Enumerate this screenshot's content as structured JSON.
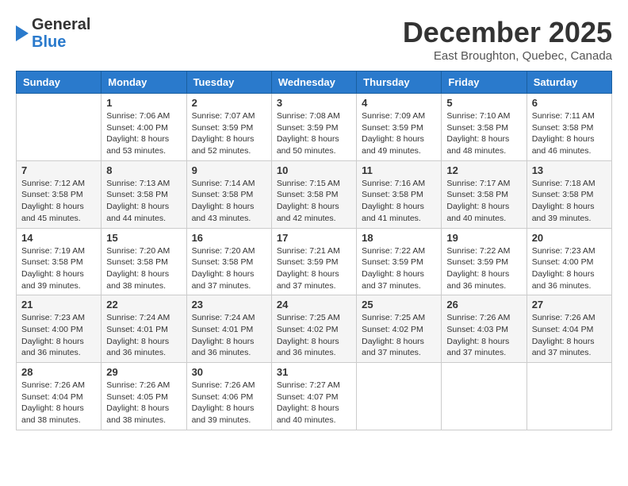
{
  "header": {
    "logo_general": "General",
    "logo_blue": "Blue",
    "month_title": "December 2025",
    "location": "East Broughton, Quebec, Canada"
  },
  "days_of_week": [
    "Sunday",
    "Monday",
    "Tuesday",
    "Wednesday",
    "Thursday",
    "Friday",
    "Saturday"
  ],
  "weeks": [
    [
      {
        "day": "",
        "sunrise": "",
        "sunset": "",
        "daylight": ""
      },
      {
        "day": "1",
        "sunrise": "Sunrise: 7:06 AM",
        "sunset": "Sunset: 4:00 PM",
        "daylight": "Daylight: 8 hours and 53 minutes."
      },
      {
        "day": "2",
        "sunrise": "Sunrise: 7:07 AM",
        "sunset": "Sunset: 3:59 PM",
        "daylight": "Daylight: 8 hours and 52 minutes."
      },
      {
        "day": "3",
        "sunrise": "Sunrise: 7:08 AM",
        "sunset": "Sunset: 3:59 PM",
        "daylight": "Daylight: 8 hours and 50 minutes."
      },
      {
        "day": "4",
        "sunrise": "Sunrise: 7:09 AM",
        "sunset": "Sunset: 3:59 PM",
        "daylight": "Daylight: 8 hours and 49 minutes."
      },
      {
        "day": "5",
        "sunrise": "Sunrise: 7:10 AM",
        "sunset": "Sunset: 3:58 PM",
        "daylight": "Daylight: 8 hours and 48 minutes."
      },
      {
        "day": "6",
        "sunrise": "Sunrise: 7:11 AM",
        "sunset": "Sunset: 3:58 PM",
        "daylight": "Daylight: 8 hours and 46 minutes."
      }
    ],
    [
      {
        "day": "7",
        "sunrise": "Sunrise: 7:12 AM",
        "sunset": "Sunset: 3:58 PM",
        "daylight": "Daylight: 8 hours and 45 minutes."
      },
      {
        "day": "8",
        "sunrise": "Sunrise: 7:13 AM",
        "sunset": "Sunset: 3:58 PM",
        "daylight": "Daylight: 8 hours and 44 minutes."
      },
      {
        "day": "9",
        "sunrise": "Sunrise: 7:14 AM",
        "sunset": "Sunset: 3:58 PM",
        "daylight": "Daylight: 8 hours and 43 minutes."
      },
      {
        "day": "10",
        "sunrise": "Sunrise: 7:15 AM",
        "sunset": "Sunset: 3:58 PM",
        "daylight": "Daylight: 8 hours and 42 minutes."
      },
      {
        "day": "11",
        "sunrise": "Sunrise: 7:16 AM",
        "sunset": "Sunset: 3:58 PM",
        "daylight": "Daylight: 8 hours and 41 minutes."
      },
      {
        "day": "12",
        "sunrise": "Sunrise: 7:17 AM",
        "sunset": "Sunset: 3:58 PM",
        "daylight": "Daylight: 8 hours and 40 minutes."
      },
      {
        "day": "13",
        "sunrise": "Sunrise: 7:18 AM",
        "sunset": "Sunset: 3:58 PM",
        "daylight": "Daylight: 8 hours and 39 minutes."
      }
    ],
    [
      {
        "day": "14",
        "sunrise": "Sunrise: 7:19 AM",
        "sunset": "Sunset: 3:58 PM",
        "daylight": "Daylight: 8 hours and 39 minutes."
      },
      {
        "day": "15",
        "sunrise": "Sunrise: 7:20 AM",
        "sunset": "Sunset: 3:58 PM",
        "daylight": "Daylight: 8 hours and 38 minutes."
      },
      {
        "day": "16",
        "sunrise": "Sunrise: 7:20 AM",
        "sunset": "Sunset: 3:58 PM",
        "daylight": "Daylight: 8 hours and 37 minutes."
      },
      {
        "day": "17",
        "sunrise": "Sunrise: 7:21 AM",
        "sunset": "Sunset: 3:59 PM",
        "daylight": "Daylight: 8 hours and 37 minutes."
      },
      {
        "day": "18",
        "sunrise": "Sunrise: 7:22 AM",
        "sunset": "Sunset: 3:59 PM",
        "daylight": "Daylight: 8 hours and 37 minutes."
      },
      {
        "day": "19",
        "sunrise": "Sunrise: 7:22 AM",
        "sunset": "Sunset: 3:59 PM",
        "daylight": "Daylight: 8 hours and 36 minutes."
      },
      {
        "day": "20",
        "sunrise": "Sunrise: 7:23 AM",
        "sunset": "Sunset: 4:00 PM",
        "daylight": "Daylight: 8 hours and 36 minutes."
      }
    ],
    [
      {
        "day": "21",
        "sunrise": "Sunrise: 7:23 AM",
        "sunset": "Sunset: 4:00 PM",
        "daylight": "Daylight: 8 hours and 36 minutes."
      },
      {
        "day": "22",
        "sunrise": "Sunrise: 7:24 AM",
        "sunset": "Sunset: 4:01 PM",
        "daylight": "Daylight: 8 hours and 36 minutes."
      },
      {
        "day": "23",
        "sunrise": "Sunrise: 7:24 AM",
        "sunset": "Sunset: 4:01 PM",
        "daylight": "Daylight: 8 hours and 36 minutes."
      },
      {
        "day": "24",
        "sunrise": "Sunrise: 7:25 AM",
        "sunset": "Sunset: 4:02 PM",
        "daylight": "Daylight: 8 hours and 36 minutes."
      },
      {
        "day": "25",
        "sunrise": "Sunrise: 7:25 AM",
        "sunset": "Sunset: 4:02 PM",
        "daylight": "Daylight: 8 hours and 37 minutes."
      },
      {
        "day": "26",
        "sunrise": "Sunrise: 7:26 AM",
        "sunset": "Sunset: 4:03 PM",
        "daylight": "Daylight: 8 hours and 37 minutes."
      },
      {
        "day": "27",
        "sunrise": "Sunrise: 7:26 AM",
        "sunset": "Sunset: 4:04 PM",
        "daylight": "Daylight: 8 hours and 37 minutes."
      }
    ],
    [
      {
        "day": "28",
        "sunrise": "Sunrise: 7:26 AM",
        "sunset": "Sunset: 4:04 PM",
        "daylight": "Daylight: 8 hours and 38 minutes."
      },
      {
        "day": "29",
        "sunrise": "Sunrise: 7:26 AM",
        "sunset": "Sunset: 4:05 PM",
        "daylight": "Daylight: 8 hours and 38 minutes."
      },
      {
        "day": "30",
        "sunrise": "Sunrise: 7:26 AM",
        "sunset": "Sunset: 4:06 PM",
        "daylight": "Daylight: 8 hours and 39 minutes."
      },
      {
        "day": "31",
        "sunrise": "Sunrise: 7:27 AM",
        "sunset": "Sunset: 4:07 PM",
        "daylight": "Daylight: 8 hours and 40 minutes."
      },
      {
        "day": "",
        "sunrise": "",
        "sunset": "",
        "daylight": ""
      },
      {
        "day": "",
        "sunrise": "",
        "sunset": "",
        "daylight": ""
      },
      {
        "day": "",
        "sunrise": "",
        "sunset": "",
        "daylight": ""
      }
    ]
  ]
}
